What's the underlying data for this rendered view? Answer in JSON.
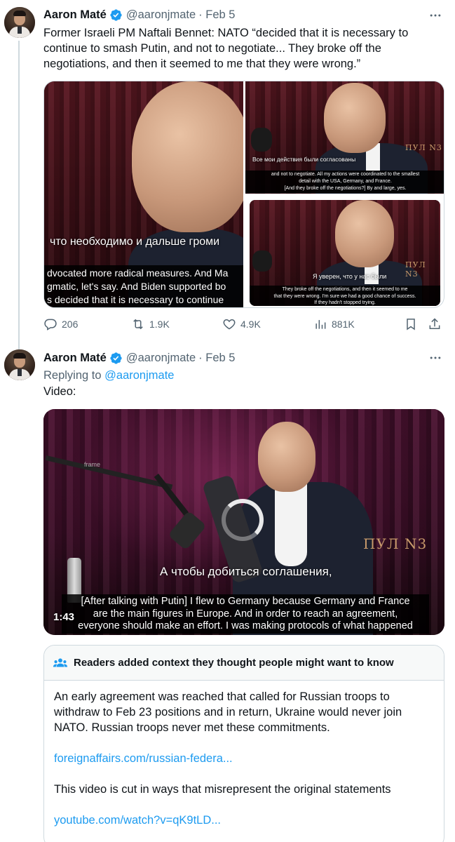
{
  "colors": {
    "accent": "#1d9bf0",
    "text": "#0f1419",
    "secondary": "#536471",
    "border": "#cfd9de"
  },
  "tweet1": {
    "name": "Aaron Maté",
    "handle": "@aaronjmate",
    "date": "· Feb 5",
    "text": "Former Israeli PM Naftali Bennet: NATO “decided that it is necessary to continue to smash Putin, and not to negotiate... They broke off the negotiations, and then it seemed to me that they were wrong.”",
    "media": {
      "img1": {
        "caption_ru": "что необходимо и дальше громи",
        "caption_en": [
          "dvocated more radical measures. And Ma",
          "gmatic, let's say. And Biden supported bo",
          "s decided that it is necessary to continue"
        ]
      },
      "img2": {
        "caption_ru": "Все мои действия были согласованы",
        "caption_en": [
          "and not to negotiate. All my actions were coordinated to the smallest",
          "detail with the USA, Germany, and France.",
          "[And they broke off the negotiations?] By and large, yes."
        ],
        "watermark": "ПУЛ N3"
      },
      "img3": {
        "caption_ru": "Я уверен, что у нас были",
        "caption_en": [
          "They broke off the negotiations, and then it seemed to me",
          "that they were wrong. I'm sure we had a good chance of success.",
          "If they hadn't stopped trying."
        ],
        "watermark": "ПУЛ N3"
      }
    },
    "actions": {
      "replies": "206",
      "reposts": "1.9K",
      "likes": "4.9K",
      "views": "881K"
    }
  },
  "tweet2": {
    "name": "Aaron Maté",
    "handle": "@aaronjmate",
    "date": "· Feb 5",
    "replying_prefix": "Replying to",
    "replying_handle": "@aaronjmate",
    "text": "Video:",
    "video": {
      "caption_ru": "А чтобы добиться соглашения,",
      "caption_en": [
        "[After talking with Putin] I flew to Germany because Germany and France",
        "are the main figures in Europe. And in order to reach an agreement,",
        "everyone should make an effort. I was making protocols of what happened"
      ],
      "watermark": "ПУЛ N3",
      "mic_label": "frame",
      "duration": "1:43"
    }
  },
  "community_note": {
    "title": "Readers added context they thought people might want to know",
    "paragraph1": "An early agreement was reached that called for Russian troops to withdraw to Feb 23 positions and in return, Ukraine would never join NATO. Russian troops never met these commitments.",
    "link1": "foreignaffairs.com/russian-federa...",
    "paragraph2": "This video is cut in ways that misrepresent the original statements",
    "link2": "youtube.com/watch?v=qK9tLD..."
  }
}
